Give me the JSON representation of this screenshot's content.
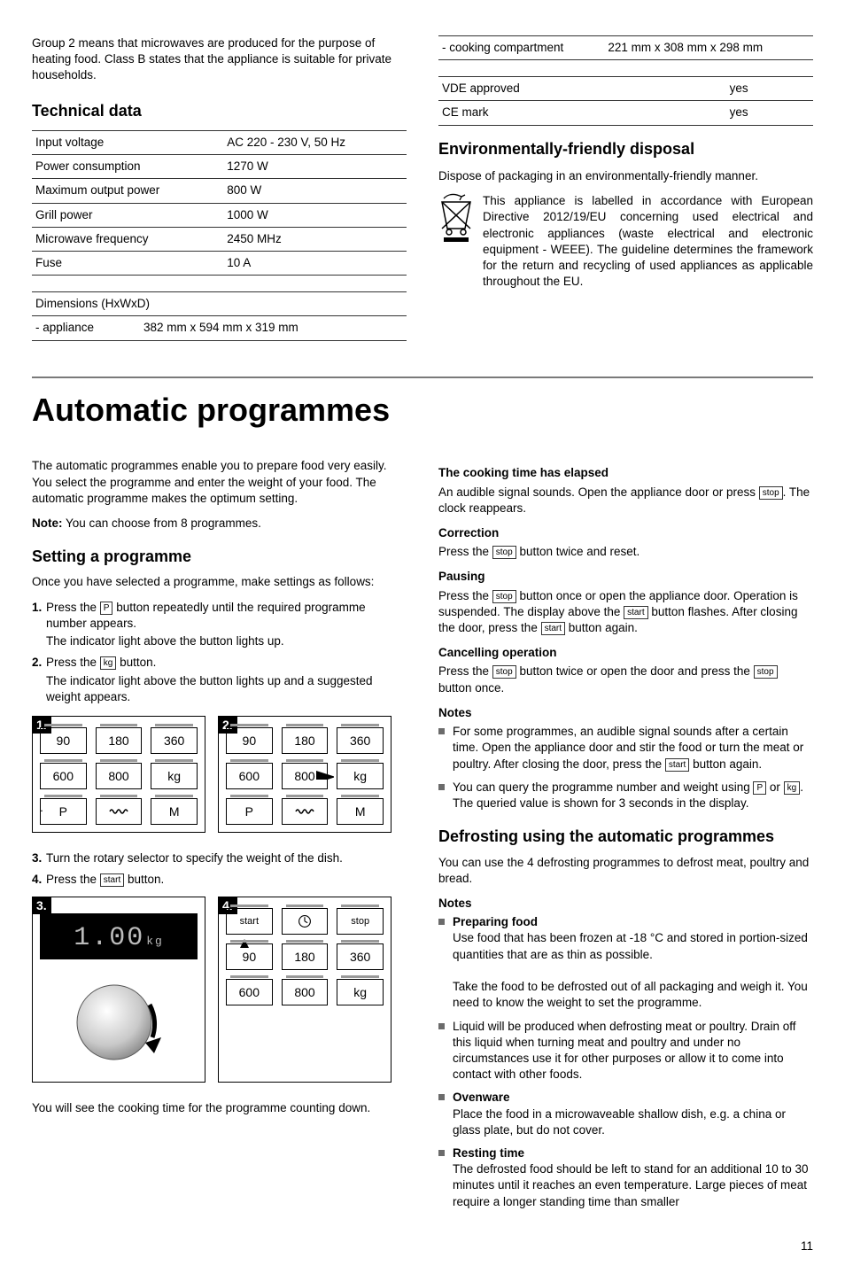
{
  "top": {
    "intro": "Group 2 means that microwaves are produced for the purpose of heating food. Class B states that the appliance is suitable for private households.",
    "tech_heading": "Technical data",
    "spec": [
      {
        "k": "Input voltage",
        "v": "AC 220 - 230 V, 50 Hz"
      },
      {
        "k": "Power consumption",
        "v": "1270 W"
      },
      {
        "k": "Maximum output power",
        "v": "800 W"
      },
      {
        "k": "Grill power",
        "v": "1000 W"
      },
      {
        "k": "Microwave frequency",
        "v": "2450 MHz"
      },
      {
        "k": "Fuse",
        "v": "10 A"
      }
    ],
    "dims_label": "Dimensions (HxWxD)",
    "dims_appliance_k": "- appliance",
    "dims_appliance_v": "382 mm x 594 mm x 319 mm",
    "dims_compartment_k": "- cooking compartment",
    "dims_compartment_v": "221 mm x 308 mm x 298 mm",
    "approvals": [
      {
        "k": "VDE approved",
        "v": "yes"
      },
      {
        "k": "CE mark",
        "v": "yes"
      }
    ],
    "env_heading": "Environmentally-friendly disposal",
    "env_para": "Dispose of packaging in an environmentally-friendly manner.",
    "env_body": "This appliance is labelled in accordance with European Directive 2012/19/EU concerning used electrical and electronic appliances (waste electrical and electronic equipment - WEEE). The guideline determines the framework for the return and recycling of used appliances as applicable throughout the EU."
  },
  "main_heading": "Automatic programmes",
  "left": {
    "intro": "The automatic programmes enable you to prepare food very easily. You select the programme and enter the weight of your food. The automatic programme makes the optimum setting.",
    "note_label": "Note:",
    "note_text": " You can choose from 8 programmes.",
    "setting_heading": "Setting a programme",
    "setting_intro": "Once you have selected a programme, make settings as follows:",
    "steps": {
      "s1_num": "1.",
      "s1_a": "Press the ",
      "s1_btn": "P",
      "s1_b": " button repeatedly until the required programme number appears.",
      "s1_follow": "The indicator light above the button lights up.",
      "s2_num": "2.",
      "s2_a": "Press the ",
      "s2_btn": "kg",
      "s2_b": " button.",
      "s2_follow": "The indicator light above the button lights up and a suggested weight appears.",
      "s3_num": "3.",
      "s3_text": "Turn the rotary selector to specify the weight of the dish.",
      "s4_num": "4.",
      "s4_a": "Press the ",
      "s4_btn": "start",
      "s4_b": " button."
    },
    "panel_buttons": {
      "b90": "90",
      "b180": "180",
      "b360": "360",
      "b600": "600",
      "b800": "800",
      "bkg": "kg",
      "bP": "P",
      "bM": "M",
      "bstart": "start",
      "bstop": "stop"
    },
    "lcd": {
      "value": "1.00",
      "unit": "kg"
    },
    "countdown": "You will see the cooking time for the programme counting down."
  },
  "right": {
    "elapsed_h": "The cooking time has elapsed",
    "elapsed_a": "An audible signal sounds. Open the appliance door or press ",
    "elapsed_btn": "stop",
    "elapsed_b": ". The clock reappears.",
    "correction_h": "Correction",
    "correction_a": "Press the ",
    "correction_btn": "stop",
    "correction_b": " button twice and reset.",
    "pausing_h": "Pausing",
    "pausing_a": "Press the ",
    "pausing_btn1": "stop",
    "pausing_b": " button once or open the appliance door. Operation is suspended. The display above the  ",
    "pausing_btn2": "start",
    "pausing_c": " button flashes. After closing the door, press the  ",
    "pausing_btn3": "start",
    "pausing_d": " button again.",
    "cancel_h": "Cancelling operation",
    "cancel_a": "Press the ",
    "cancel_btn1": "stop",
    "cancel_b": " button twice or open the door and press the ",
    "cancel_btn2": "stop",
    "cancel_c": " button once.",
    "notes_h": "Notes",
    "note1_a": "For some programmes, an audible signal sounds after a certain time. Open the appliance door and stir the food or turn the meat or poultry. After closing the door, press the ",
    "note1_btn": "start",
    "note1_b": " button again.",
    "note2_a": "You can query the programme number and weight using ",
    "note2_btn1": "P",
    "note2_b": " or ",
    "note2_btn2": "kg",
    "note2_c": ". The queried value is shown for 3 seconds in the display.",
    "defrost_h": "Defrosting using the automatic programmes",
    "defrost_intro": "You can use the 4 defrosting programmes to defrost meat, poultry and bread.",
    "defrost_notes_h": "Notes",
    "prep_h": "Preparing food",
    "prep_p1": "Use food that has been frozen at -18 °C and stored in portion-sized quantities that are as thin as possible.",
    "prep_p2": "Take the food to be defrosted out of all packaging and weigh it. You need to know the weight to set the programme.",
    "liquid": "Liquid will be produced when defrosting meat or poultry. Drain off this liquid when turning meat and poultry and under no circumstances use it for other purposes or allow it to come into contact with other foods.",
    "oven_h": "Ovenware",
    "oven_p": "Place the food in a microwaveable shallow dish, e.g. a china or glass plate, but do not cover.",
    "rest_h": "Resting time",
    "rest_p": "The defrosted food should be left to stand for an additional 10 to 30 minutes until it reaches an even temperature. Large pieces of meat require a longer standing time than smaller"
  },
  "pagenum": "11"
}
